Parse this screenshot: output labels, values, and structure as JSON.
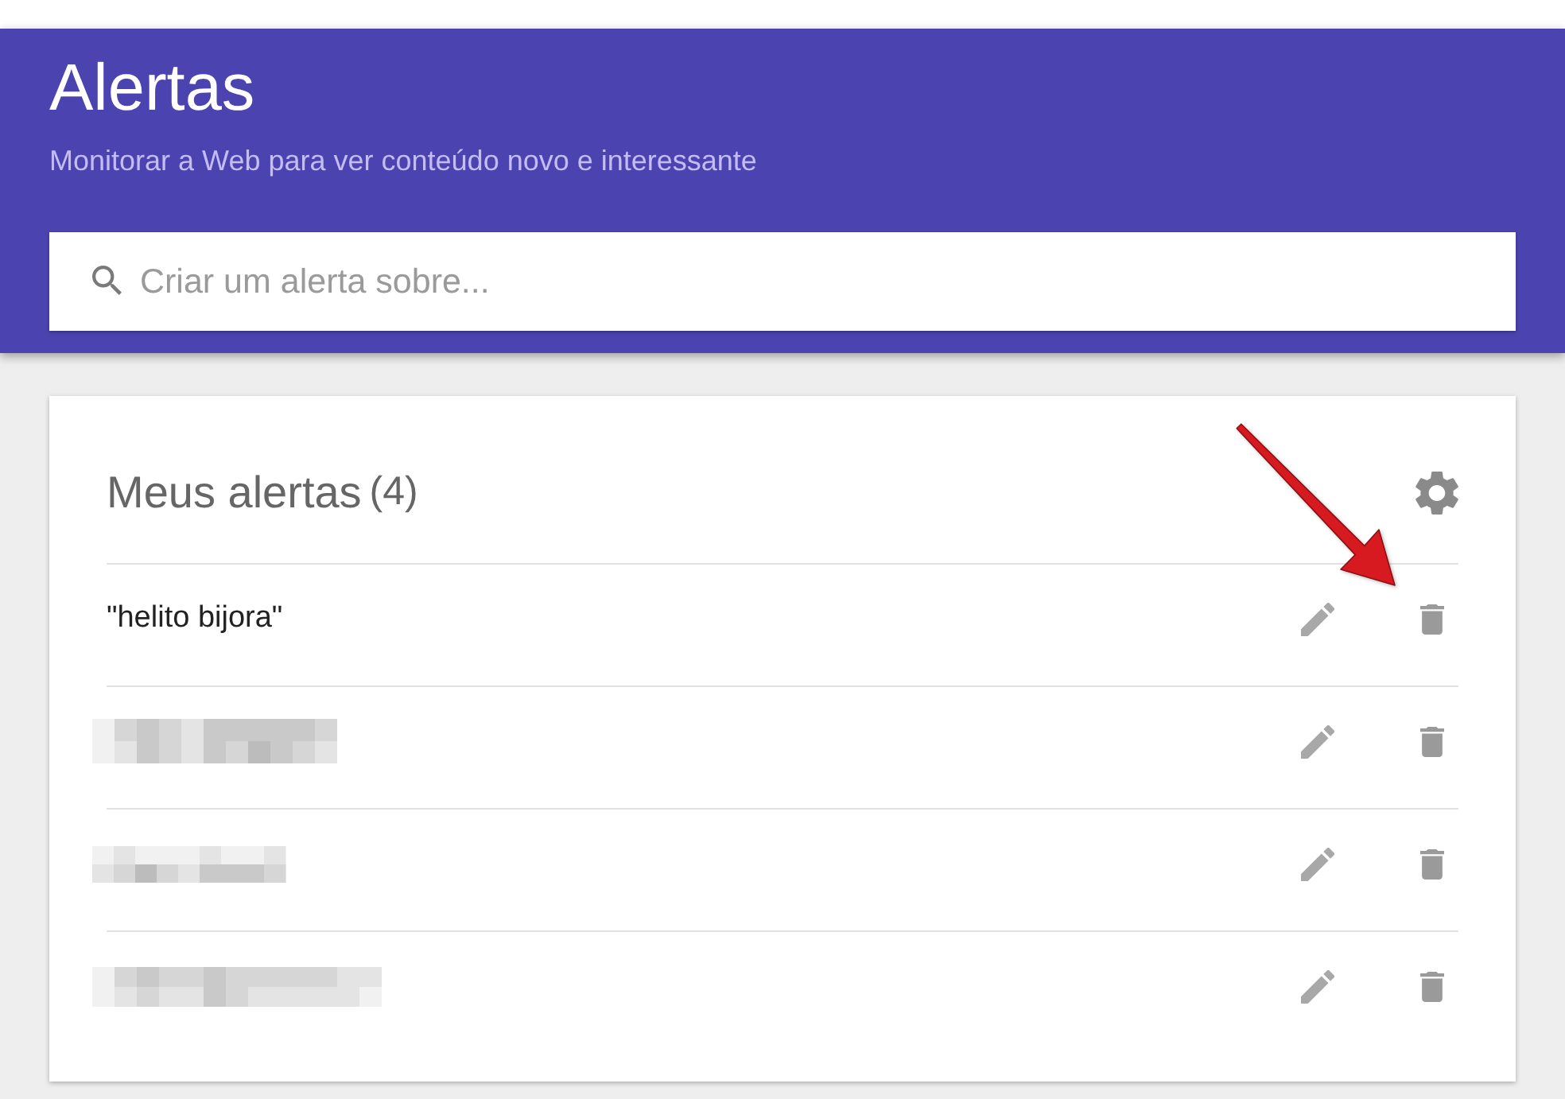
{
  "header": {
    "title": "Alertas",
    "subtitle": "Monitorar a Web para ver conteúdo novo e interessante"
  },
  "search": {
    "placeholder": "Criar um alerta sobre..."
  },
  "my_alerts": {
    "title": "Meus alertas",
    "count": "(4)",
    "alerts": [
      {
        "query": "\"helito bijora\"",
        "redacted": false
      },
      {
        "redacted": true
      },
      {
        "redacted": true
      },
      {
        "redacted": true
      }
    ]
  }
}
